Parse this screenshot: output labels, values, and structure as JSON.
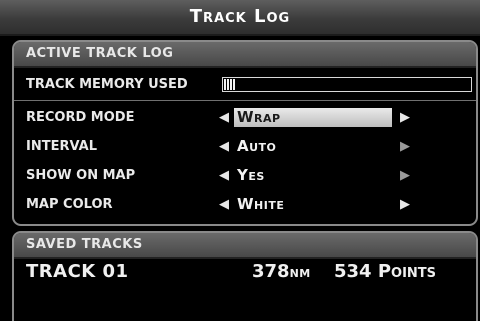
{
  "window": {
    "title": "Track Log"
  },
  "active_track_log": {
    "header": "ACTIVE TRACK LOG",
    "memory": {
      "label": "TRACK MEMORY USED",
      "fraction_used": 0.05
    },
    "rows": [
      {
        "label": "RECORD MODE",
        "value": "Wrap",
        "selected": true
      },
      {
        "label": "INTERVAL",
        "value": "Auto",
        "selected": false
      },
      {
        "label": "SHOW ON MAP",
        "value": "Yes",
        "selected": false
      },
      {
        "label": "MAP COLOR",
        "value": "White",
        "selected": false
      }
    ],
    "arrow_left": "◀",
    "arrow_right": "▶"
  },
  "saved_tracks": {
    "header": "SAVED TRACKS",
    "tracks": [
      {
        "name": "TRACK 01",
        "distance": "378",
        "unit": "NM",
        "points": "534 Points"
      }
    ]
  }
}
